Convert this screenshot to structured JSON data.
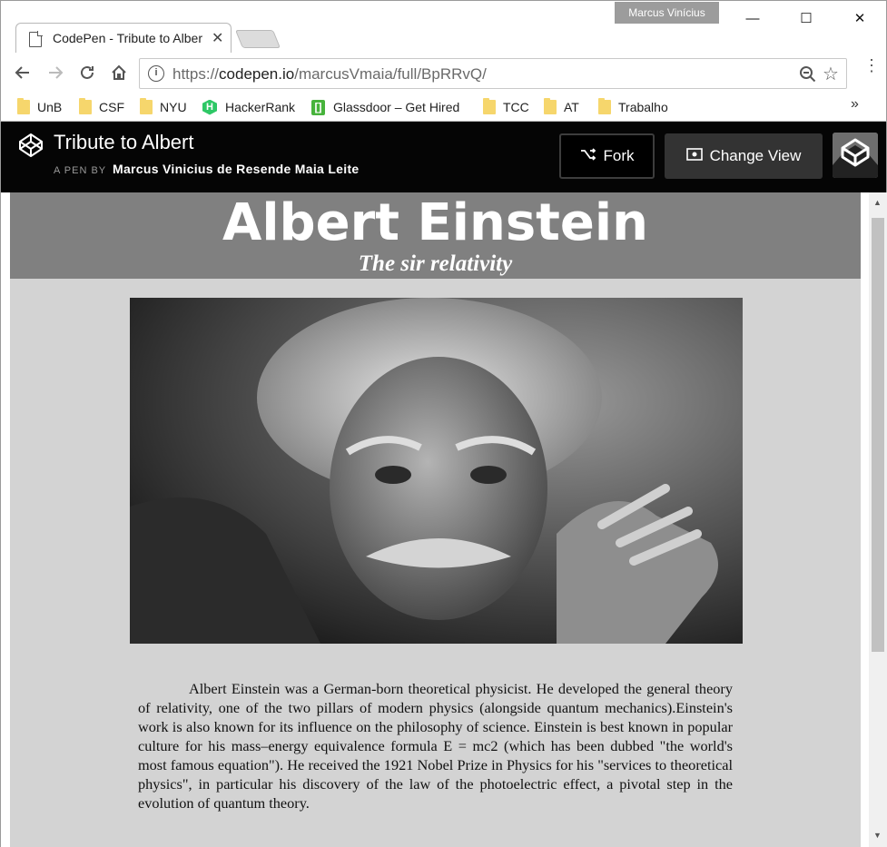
{
  "window": {
    "user": "Marcus Vinícius",
    "minimize": "—",
    "maximize": "☐",
    "close": "✕"
  },
  "tab": {
    "title": "CodePen - Tribute to Albert",
    "close": "✕"
  },
  "address_bar": {
    "scheme": "https://",
    "host": "codepen.io",
    "path": "/marcusVmaia/full/BpRRvQ/"
  },
  "bookmarks": [
    {
      "label": "UnB",
      "icon": "folder-icon"
    },
    {
      "label": "CSF",
      "icon": "folder-icon"
    },
    {
      "label": "NYU",
      "icon": "folder-icon"
    },
    {
      "label": "HackerRank",
      "icon": "hackerrank-icon"
    },
    {
      "label": "Glassdoor – Get Hired",
      "icon": "glassdoor-icon"
    },
    {
      "label": "TCC",
      "icon": "folder-icon"
    },
    {
      "label": "AT",
      "icon": "folder-icon"
    },
    {
      "label": "Trabalho",
      "icon": "folder-icon"
    }
  ],
  "bookmarks_more": "»",
  "codepen": {
    "pen_title": "Tribute to Albert",
    "byline": "A PEN BY",
    "author": "Marcus Vinicius de Resende Maia Leite",
    "fork_label": "Fork",
    "change_view_label": "Change View"
  },
  "page": {
    "title": "Albert Einstein",
    "subtitle": "The sir relativity",
    "bio": "Albert Einstein was a German-born theoretical physicist. He developed the general theory of relativity, one of the two pillars of modern physics (alongside quantum mechanics).Einstein's work is also known for its influence on the philosophy of science. Einstein is best known in popular culture for his mass–energy equivalence formula E = mc2 (which has been dubbed \"the world's most famous equation\"). He received the 1921 Nobel Prize in Physics for his \"services to theoretical physics\", in particular his discovery of the law of the photoelectric effect, a pivotal step in the evolution of quantum theory."
  },
  "colors": {
    "codepen_header": "#050505",
    "hero_bg": "#808080",
    "page_bg": "#d3d3d3"
  }
}
